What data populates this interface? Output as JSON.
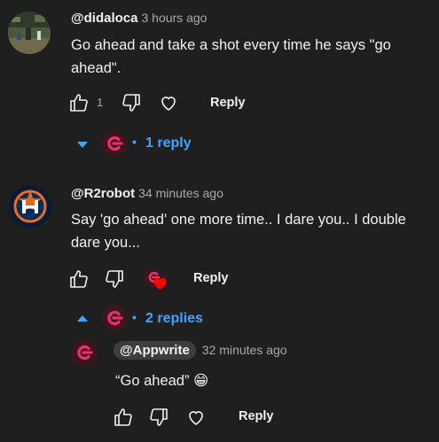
{
  "comments": [
    {
      "handle": "@didaloca",
      "time": "3 hours ago",
      "text_line1": "Go ahead and take a shot every time he says \"go",
      "text_line2": "ahead\".",
      "likes": "1",
      "reply_label": "Reply",
      "replies_label": "1 reply",
      "avatar_icon": "game-scene-avatar-icon"
    },
    {
      "handle": "@R2robot",
      "time": "34 minutes ago",
      "text_line1": "Say 'go ahead' one more time.. I dare you.. I double",
      "text_line2": "dare you...",
      "reply_label": "Reply",
      "replies_label": "2 replies",
      "avatar_icon": "astros-logo-avatar-icon"
    }
  ],
  "nested_reply": {
    "handle": "@Appwrite",
    "time": "32 minutes ago",
    "text": "“Go ahead” 😁",
    "reply_label": "Reply",
    "avatar_icon": "appwrite-logo-avatar-icon"
  },
  "colors": {
    "background": "#1f1f1f",
    "link": "#3ea6ff",
    "appwrite": "#f02e65",
    "heart": "#ff0000",
    "astros_navy": "#002d62",
    "astros_orange": "#eb6e1f"
  }
}
